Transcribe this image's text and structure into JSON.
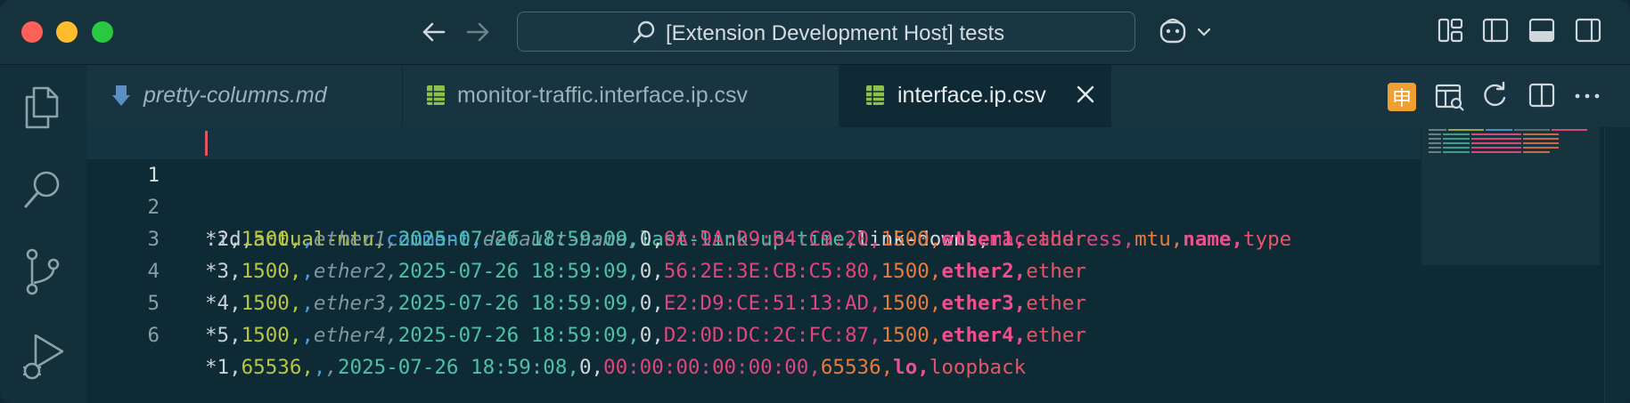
{
  "window": {
    "search_text": "[Extension Development Host] tests"
  },
  "tabs": [
    {
      "label": "pretty-columns.md",
      "icon": "markdown-download-icon"
    },
    {
      "label": "monitor-traffic.interface.ip.csv",
      "icon": "csv-table-icon"
    },
    {
      "label": "interface.ip.csv",
      "icon": "csv-table-icon",
      "active": true
    }
  ],
  "editor_actions": {
    "badge_char": "申",
    "badge_color": "#f0a030"
  },
  "editor": {
    "lines": [
      {
        "num": "1",
        "tokens": [
          {
            "t": ".id",
            "c": "c0"
          },
          {
            "t": ",",
            "c": "c0"
          },
          {
            "t": "actual-mtu",
            "c": "c1"
          },
          {
            "t": ",",
            "c": "c1"
          },
          {
            "t": "comment",
            "c": "c2"
          },
          {
            "t": ",",
            "c": "c2"
          },
          {
            "t": "default-name",
            "c": "c3"
          },
          {
            "t": ",",
            "c": "c3"
          },
          {
            "t": "last-link-up-time",
            "c": "c4"
          },
          {
            "t": ",",
            "c": "c4"
          },
          {
            "t": "link-downs",
            "c": "c5"
          },
          {
            "t": ",",
            "c": "c5"
          },
          {
            "t": "mac-address",
            "c": "c6"
          },
          {
            "t": ",",
            "c": "c6"
          },
          {
            "t": "mtu",
            "c": "c7"
          },
          {
            "t": ",",
            "c": "c7"
          },
          {
            "t": "name",
            "c": "c8"
          },
          {
            "t": ",",
            "c": "c8"
          },
          {
            "t": "type",
            "c": "c9"
          }
        ]
      },
      {
        "num": "2",
        "tokens": [
          {
            "t": "*2,",
            "c": "c0"
          },
          {
            "t": "1500,",
            "c": "c1"
          },
          {
            "t": ",",
            "c": "c2"
          },
          {
            "t": "ether1",
            "c": "c3"
          },
          {
            "t": ",",
            "c": "c3"
          },
          {
            "t": "2025-07-26 18:59:09,",
            "c": "c4"
          },
          {
            "t": "0,",
            "c": "c5"
          },
          {
            "t": "0A:9A:09:B4:C9:20,",
            "c": "c6"
          },
          {
            "t": "1500,",
            "c": "c7"
          },
          {
            "t": "ether1,",
            "c": "c8"
          },
          {
            "t": "ether",
            "c": "c9"
          }
        ]
      },
      {
        "num": "3",
        "tokens": [
          {
            "t": "*3,",
            "c": "c0"
          },
          {
            "t": "1500,",
            "c": "c1"
          },
          {
            "t": ",",
            "c": "c2"
          },
          {
            "t": "ether2",
            "c": "c3"
          },
          {
            "t": ",",
            "c": "c3"
          },
          {
            "t": "2025-07-26 18:59:09,",
            "c": "c4"
          },
          {
            "t": "0,",
            "c": "c5"
          },
          {
            "t": "56:2E:3E:CB:C5:80,",
            "c": "c6"
          },
          {
            "t": "1500,",
            "c": "c7"
          },
          {
            "t": "ether2,",
            "c": "c8"
          },
          {
            "t": "ether",
            "c": "c9"
          }
        ]
      },
      {
        "num": "4",
        "tokens": [
          {
            "t": "*4,",
            "c": "c0"
          },
          {
            "t": "1500,",
            "c": "c1"
          },
          {
            "t": ",",
            "c": "c2"
          },
          {
            "t": "ether3",
            "c": "c3"
          },
          {
            "t": ",",
            "c": "c3"
          },
          {
            "t": "2025-07-26 18:59:09,",
            "c": "c4"
          },
          {
            "t": "0,",
            "c": "c5"
          },
          {
            "t": "E2:D9:CE:51:13:AD,",
            "c": "c6"
          },
          {
            "t": "1500,",
            "c": "c7"
          },
          {
            "t": "ether3,",
            "c": "c8"
          },
          {
            "t": "ether",
            "c": "c9"
          }
        ]
      },
      {
        "num": "5",
        "tokens": [
          {
            "t": "*5,",
            "c": "c0"
          },
          {
            "t": "1500,",
            "c": "c1"
          },
          {
            "t": ",",
            "c": "c2"
          },
          {
            "t": "ether4",
            "c": "c3"
          },
          {
            "t": ",",
            "c": "c3"
          },
          {
            "t": "2025-07-26 18:59:09,",
            "c": "c4"
          },
          {
            "t": "0,",
            "c": "c5"
          },
          {
            "t": "D2:0D:DC:2C:FC:87,",
            "c": "c6"
          },
          {
            "t": "1500,",
            "c": "c7"
          },
          {
            "t": "ether4,",
            "c": "c8"
          },
          {
            "t": "ether",
            "c": "c9"
          }
        ]
      },
      {
        "num": "6",
        "tokens": [
          {
            "t": "*1,",
            "c": "c0"
          },
          {
            "t": "65536,",
            "c": "c1"
          },
          {
            "t": ",",
            "c": "c2"
          },
          {
            "t": ",",
            "c": "c3"
          },
          {
            "t": "2025-07-26 18:59:08,",
            "c": "c4"
          },
          {
            "t": "0,",
            "c": "c5"
          },
          {
            "t": "00:00:00:00:00:00,",
            "c": "c6"
          },
          {
            "t": "65536,",
            "c": "c7"
          },
          {
            "t": "lo,",
            "c": "c8"
          },
          {
            "t": "loopback",
            "c": "c9"
          }
        ]
      }
    ]
  },
  "colors": {
    "red_light": "#fe5f57",
    "yellow_light": "#febc2e",
    "green_light": "#28c840",
    "editor_bg": "#0e2a34",
    "accent_cursor": "#e05561"
  }
}
